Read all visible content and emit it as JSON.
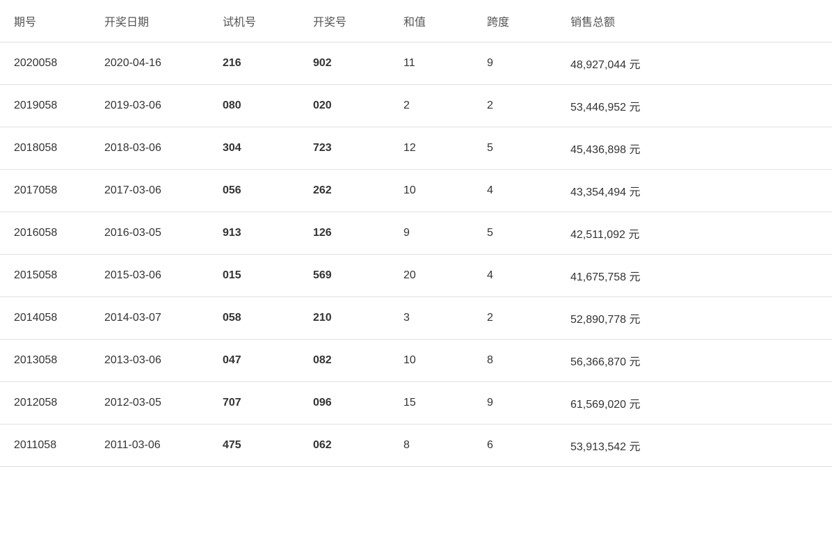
{
  "table": {
    "headers": [
      "期号",
      "开奖日期",
      "试机号",
      "开奖号",
      "和值",
      "跨度",
      "销售总额"
    ],
    "rows": [
      {
        "qihao": "2020058",
        "date": "2020-04-16",
        "shiji": "216",
        "kaijang": "902",
        "hezhi": "11",
        "kuadu": "9",
        "sales": "48,927,044 元"
      },
      {
        "qihao": "2019058",
        "date": "2019-03-06",
        "shiji": "080",
        "kaijang": "020",
        "hezhi": "2",
        "kuadu": "2",
        "sales": "53,446,952 元"
      },
      {
        "qihao": "2018058",
        "date": "2018-03-06",
        "shiji": "304",
        "kaijang": "723",
        "hezhi": "12",
        "kuadu": "5",
        "sales": "45,436,898 元"
      },
      {
        "qihao": "2017058",
        "date": "2017-03-06",
        "shiji": "056",
        "kaijang": "262",
        "hezhi": "10",
        "kuadu": "4",
        "sales": "43,354,494 元"
      },
      {
        "qihao": "2016058",
        "date": "2016-03-05",
        "shiji": "913",
        "kaijang": "126",
        "hezhi": "9",
        "kuadu": "5",
        "sales": "42,511,092 元"
      },
      {
        "qihao": "2015058",
        "date": "2015-03-06",
        "shiji": "015",
        "kaijang": "569",
        "hezhi": "20",
        "kuadu": "4",
        "sales": "41,675,758 元"
      },
      {
        "qihao": "2014058",
        "date": "2014-03-07",
        "shiji": "058",
        "kaijang": "210",
        "hezhi": "3",
        "kuadu": "2",
        "sales": "52,890,778 元"
      },
      {
        "qihao": "2013058",
        "date": "2013-03-06",
        "shiji": "047",
        "kaijang": "082",
        "hezhi": "10",
        "kuadu": "8",
        "sales": "56,366,870 元"
      },
      {
        "qihao": "2012058",
        "date": "2012-03-05",
        "shiji": "707",
        "kaijang": "096",
        "hezhi": "15",
        "kuadu": "9",
        "sales": "61,569,020 元"
      },
      {
        "qihao": "2011058",
        "date": "2011-03-06",
        "shiji": "475",
        "kaijang": "062",
        "hezhi": "8",
        "kuadu": "6",
        "sales": "53,913,542 元"
      }
    ]
  }
}
